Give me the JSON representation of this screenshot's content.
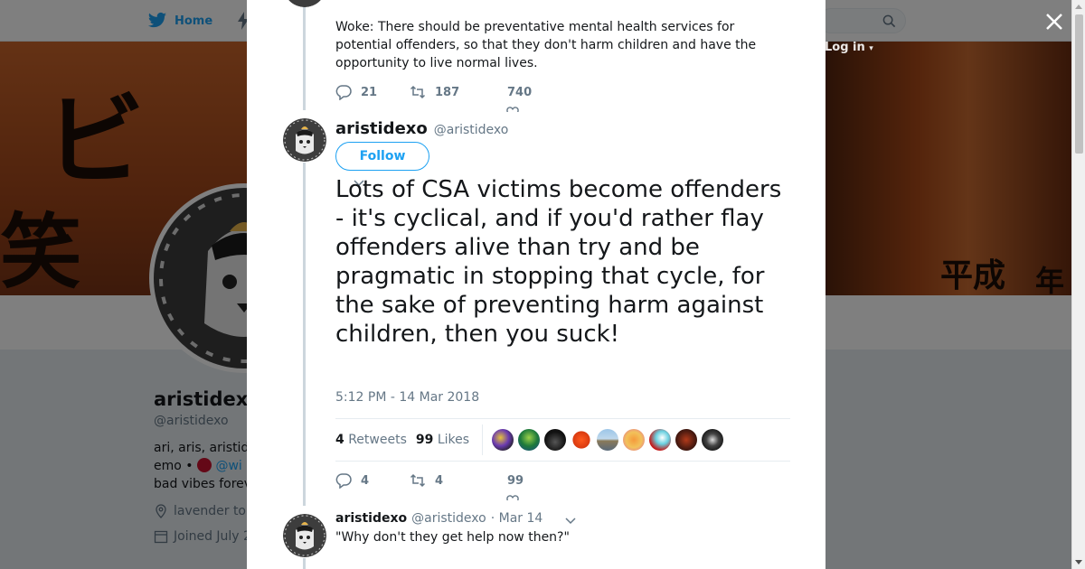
{
  "nav": {
    "home_label": "Home",
    "login_label": "Log in"
  },
  "profile": {
    "name": "aristidexo",
    "handle": "@aristidexo",
    "bio_line1": "ari, aris, aristid",
    "bio_line2_prefix": "emo •",
    "bio_line2_link": "@wi",
    "bio_line3": "bad vibes forev",
    "location": "lavender to",
    "joined": "Joined July 2"
  },
  "modal": {
    "prev_tweet": {
      "text": "Woke: There should be preventative mental health services for potential offenders, so that they don't harm children and have the opportunity to live normal lives.",
      "replies": "21",
      "retweets": "187",
      "likes": "740"
    },
    "main_tweet": {
      "author_name": "aristidexo",
      "author_handle": "@aristidexo",
      "follow_label": "Follow",
      "text": "Lots of CSA victims become offenders - it's cyclical, and if you'd rather flay offenders alive than try and be pragmatic in stopping that cycle, for the sake of preventing harm against children, then you suck!",
      "timestamp": "5:12 PM - 14 Mar 2018",
      "retweet_count": "4",
      "retweet_label": "Retweets",
      "like_count": "99",
      "like_label": "Likes",
      "replies": "4",
      "retweets": "4",
      "likes": "99"
    },
    "reply_tweet": {
      "author_name": "aristidexo",
      "author_handle": "@aristidexo",
      "date": "· Mar 14",
      "text": "\"Why don't they get help now then?\""
    }
  },
  "colors": {
    "accent": "#1da1f2",
    "text": "#14171a",
    "muted": "#657786",
    "border": "#e6ecf0"
  }
}
